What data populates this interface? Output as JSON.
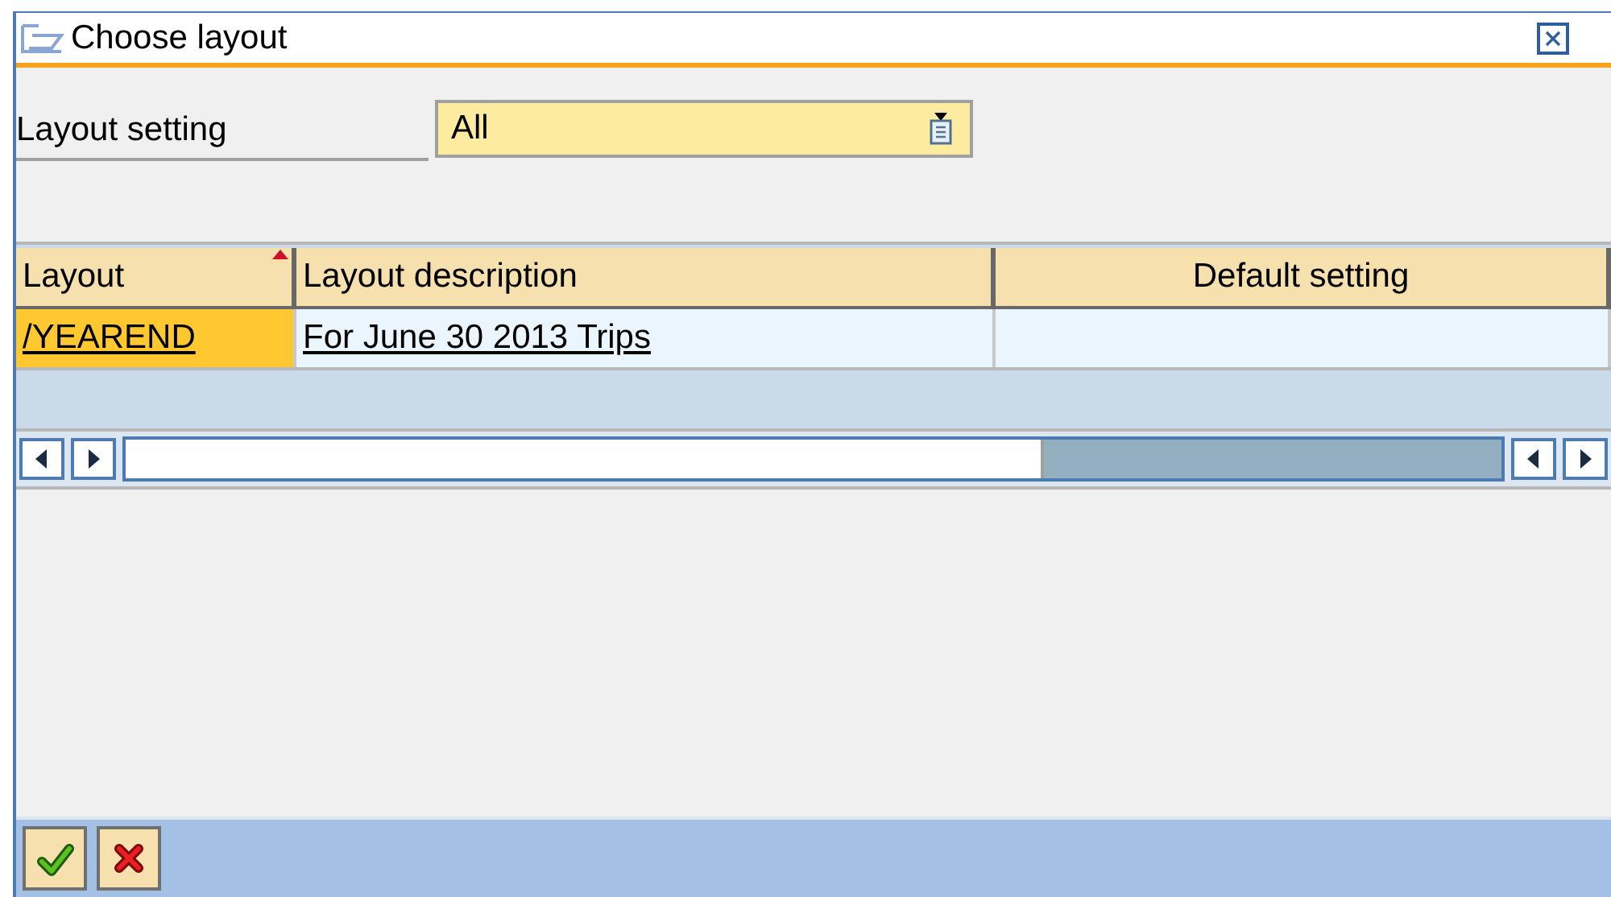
{
  "window": {
    "title": "Choose layout"
  },
  "layout_setting": {
    "label": "Layout setting",
    "value": "All"
  },
  "table": {
    "columns": [
      {
        "label": "Layout",
        "sorted": true
      },
      {
        "label": "Layout description",
        "sorted": false
      },
      {
        "label": "Default setting",
        "sorted": false
      }
    ],
    "rows": [
      {
        "cells": [
          "/YEAREND",
          "For June 30 2013 Trips"
        ]
      }
    ]
  },
  "buttons": [
    {
      "kind": "confirm"
    },
    {
      "kind": "cancel"
    }
  ]
}
